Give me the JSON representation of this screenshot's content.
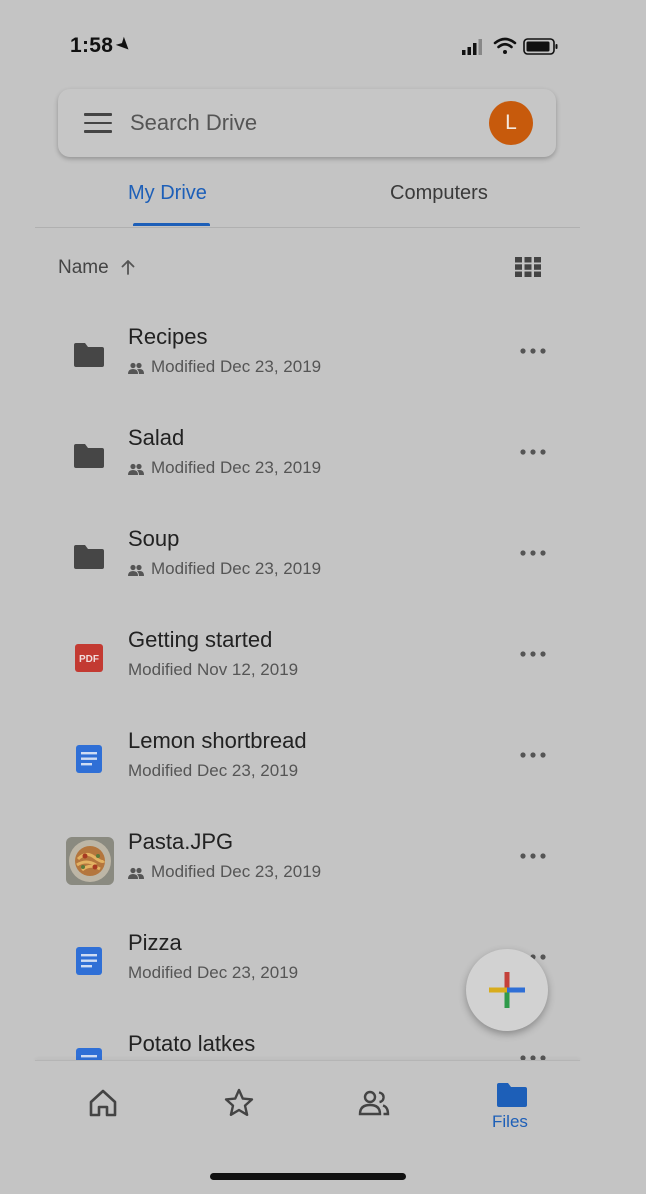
{
  "status_bar": {
    "time": "1:58"
  },
  "search": {
    "placeholder": "Search Drive",
    "avatar_letter": "L"
  },
  "tabs": [
    {
      "label": "My Drive",
      "active": true
    },
    {
      "label": "Computers",
      "active": false
    }
  ],
  "sort": {
    "label": "Name",
    "direction": "ascending"
  },
  "files": [
    {
      "name": "Recipes",
      "modified": "Modified Dec 23, 2019",
      "type": "folder",
      "shared": true
    },
    {
      "name": "Salad",
      "modified": "Modified Dec 23, 2019",
      "type": "folder",
      "shared": true
    },
    {
      "name": "Soup",
      "modified": "Modified Dec 23, 2019",
      "type": "folder",
      "shared": true
    },
    {
      "name": "Getting started",
      "modified": "Modified Nov 12, 2019",
      "type": "pdf",
      "shared": false,
      "icon_text": "PDF"
    },
    {
      "name": "Lemon shortbread",
      "modified": "Modified Dec 23, 2019",
      "type": "doc",
      "shared": false
    },
    {
      "name": "Pasta.JPG",
      "modified": "Modified Dec 23, 2019",
      "type": "image",
      "shared": true
    },
    {
      "name": "Pizza",
      "modified": "Modified Dec 23, 2019",
      "type": "doc",
      "shared": false
    },
    {
      "name": "Potato latkes",
      "modified": "",
      "type": "doc",
      "shared": false
    }
  ],
  "bottom_nav": {
    "items": [
      {
        "icon": "home-icon",
        "label": ""
      },
      {
        "icon": "star-icon",
        "label": ""
      },
      {
        "icon": "people-icon",
        "label": ""
      },
      {
        "icon": "folder-icon",
        "label": "Files",
        "active": true
      }
    ]
  },
  "colors": {
    "accent": "#1d5fb8",
    "avatar": "#c75a0c",
    "pdf": "#c33a32",
    "doc": "#2f6fd6",
    "folder": "#464646"
  }
}
